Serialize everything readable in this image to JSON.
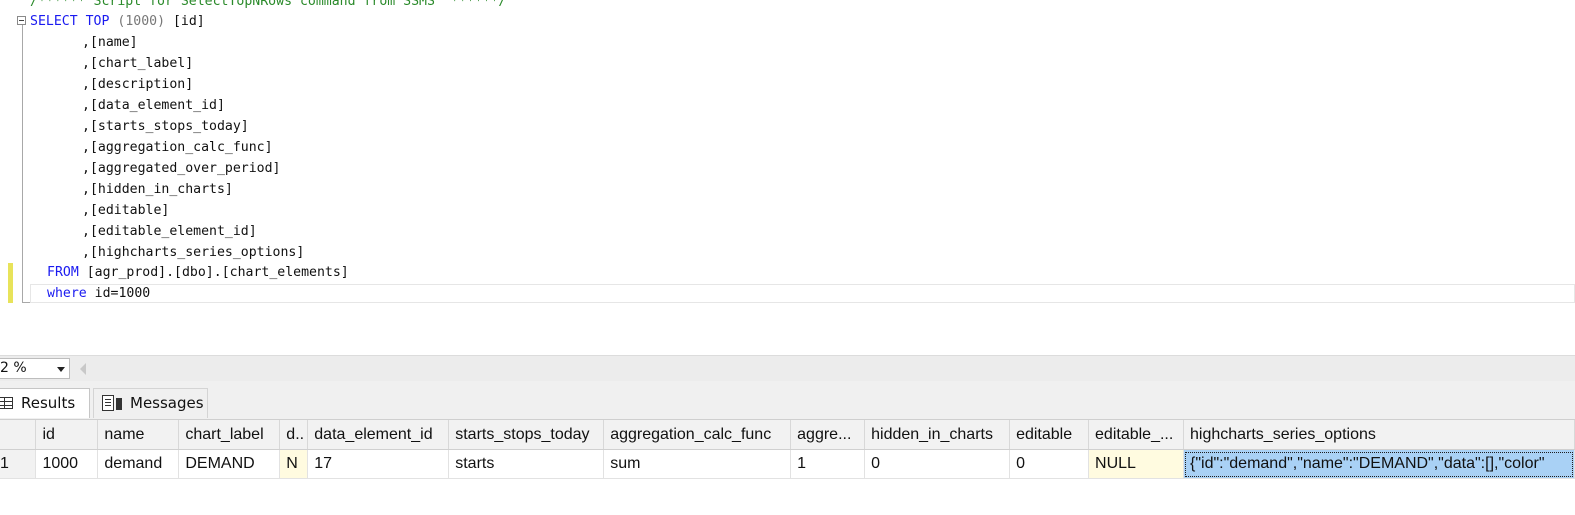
{
  "editor": {
    "comment_line": "/****** Script for SelectTopNRows command from SSMS  ******/",
    "select_kw": "SELECT",
    "top_kw": "TOP",
    "top_value": "(1000)",
    "first_column": "[id]",
    "columns": [
      ",[name]",
      ",[chart_label]",
      ",[description]",
      ",[data_element_id]",
      ",[starts_stops_today]",
      ",[aggregation_calc_func]",
      ",[aggregated_over_period]",
      ",[hidden_in_charts]",
      ",[editable]",
      ",[editable_element_id]",
      ",[highcharts_series_options]"
    ],
    "from_kw": "FROM",
    "from_table": "[agr_prod].[dbo].[chart_elements]",
    "where_kw": "where",
    "where_clause": "id=1000"
  },
  "zoom": {
    "value": "2 %"
  },
  "tabs": {
    "results_label": "Results",
    "messages_label": "Messages"
  },
  "grid": {
    "headers": [
      "id",
      "name",
      "chart_label",
      "d..",
      "data_element_id",
      "starts_stops_today",
      "aggregation_calc_func",
      "aggre...",
      "hidden_in_charts",
      "editable",
      "editable_...",
      "highcharts_series_options"
    ],
    "rows": [
      {
        "rownum": "1",
        "cells": [
          "1000",
          "demand",
          "DEMAND",
          "N",
          "17",
          "starts",
          "sum",
          "1",
          "0",
          "0",
          "NULL",
          "{\"id\":\"demand\",\"name\":\"DEMAND\",\"data\":[],\"color\""
        ]
      }
    ]
  }
}
